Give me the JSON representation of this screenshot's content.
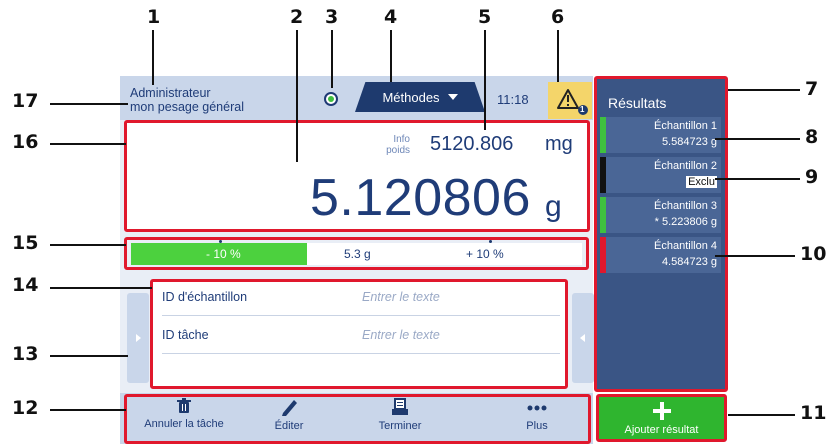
{
  "callouts": {
    "n1": "1",
    "n2": "2",
    "n3": "3",
    "n4": "4",
    "n5": "5",
    "n6": "6",
    "n7": "7",
    "n8": "8",
    "n9": "9",
    "n10": "10",
    "n11": "11",
    "n12": "12",
    "n13": "13",
    "n14": "14",
    "n15": "15",
    "n16": "16",
    "n17": "17"
  },
  "header": {
    "user_line1": "Administrateur",
    "user_line2": "mon pesage général",
    "status_icon": "status-ok-icon",
    "methods_label": "Méthodes",
    "time": "11:18",
    "warning_icon": "warning-icon",
    "warning_count": "1"
  },
  "weight": {
    "info_label_1": "Info",
    "info_label_2": "poids",
    "info_value": "5120.806",
    "info_unit": "mg",
    "main_value": "5.120806",
    "main_unit": "g"
  },
  "tolerance": {
    "lower": "- 10 %",
    "target": "5.3 g",
    "upper": "+ 10 %",
    "fill_fraction": 0.39,
    "fill_color": "#4cd13e"
  },
  "form": {
    "rows": [
      {
        "label": "ID d'échantillon",
        "placeholder": "Entrer le texte"
      },
      {
        "label": "ID tâche",
        "placeholder": "Entrer le texte"
      }
    ]
  },
  "toolbar": {
    "cancel_label": "Annuler la tâche",
    "edit_label": "Éditer",
    "finish_label": "Terminer",
    "more_label": "Plus",
    "cancel_icon": "trash-icon",
    "edit_icon": "pencil-icon",
    "finish_icon": "printer-icon",
    "more_icon": "more-dots-icon"
  },
  "results": {
    "title": "Résultats",
    "samples": [
      {
        "name": "Échantillon 1",
        "value": "5.584723 g",
        "status_color": "#3fc03f"
      },
      {
        "name": "Échantillon 2",
        "value": "Exclu",
        "status_color": "#111111"
      },
      {
        "name": "Échantillon 3",
        "value": "* 5.223806 g",
        "status_color": "#3fc03f"
      },
      {
        "name": "Échantillon 4",
        "value": "4.584723 g",
        "status_color": "#e0182d"
      }
    ],
    "add_label": "Ajouter résultat"
  },
  "colors": {
    "accent_dark": "#1e3a6e",
    "highlight_red": "#e0182d",
    "ok_green": "#2fb52f",
    "warning_yellow": "#f4d56a"
  }
}
